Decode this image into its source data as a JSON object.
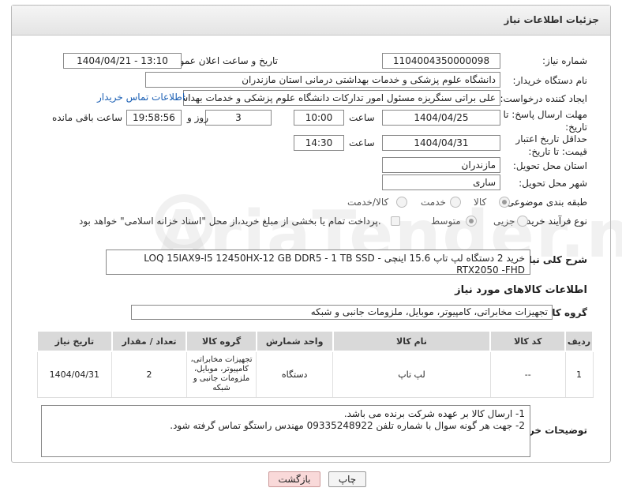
{
  "panel": {
    "title": "جزئیات اطلاعات نیاز"
  },
  "form": {
    "need_number": {
      "label": "شماره نیاز:",
      "value": "1104004350000098"
    },
    "announce": {
      "label": "تاریخ و ساعت اعلان عمومی:",
      "value": "1404/04/21 - 13:10"
    },
    "buyer_org": {
      "label": "نام دستگاه خریدار:",
      "value": "دانشگاه علوم پزشکی و خدمات بهداشتی  درمانی استان مازندران"
    },
    "creator": {
      "label": "ایجاد کننده درخواست:",
      "value": "علی براتی سنگریزه مسئول امور تدارکات دانشگاه علوم پزشکی و خدمات بهداشتی",
      "contact_link": "اطلاعات تماس خریدار"
    },
    "reply_deadline": {
      "label": "مهلت ارسال پاسخ: تا تاریخ:",
      "date": "1404/04/25",
      "time_label": "ساعت",
      "time": "10:00",
      "days": "3",
      "days_label": "روز و",
      "remaining": "19:58:56",
      "remaining_label": "ساعت باقی مانده"
    },
    "price_validity": {
      "label": "حداقل تاریخ اعتبار قیمت: تا تاریخ:",
      "date": "1404/04/31",
      "time_label": "ساعت",
      "time": "14:30"
    },
    "province": {
      "label": "استان محل تحویل:",
      "value": "مازندران"
    },
    "city": {
      "label": "شهر محل تحویل:",
      "value": "ساری"
    },
    "category": {
      "label": "طبقه بندی موضوعی:",
      "options": [
        "کالا",
        "خدمت",
        "کالا/خدمت"
      ],
      "selected": "کالا"
    },
    "process": {
      "label": "نوع فرآیند خرید :",
      "options": [
        "جزیی",
        "متوسط"
      ],
      "selected": "متوسط",
      "note": "پرداخت تمام یا بخشی از مبلغ خرید،از محل \"اسناد خزانه اسلامی\" خواهد بود."
    }
  },
  "description": {
    "label": "شرح کلی نیاز:",
    "value": "خرید 2 دستگاه لپ تاپ  15.6 اینچی LOQ 15IAX9-I5 12450HX-12 GB DDR5 - 1 TB SSD - RTX2050 -FHD"
  },
  "goods": {
    "section_title": "اطلاعات کالاهای مورد نیاز",
    "group_label": "گروه کالا:",
    "group_value": "تجهیزات مخابراتی، کامپیوتر، موبایل، ملزومات جانبی و شبکه",
    "columns": [
      "ردیف",
      "کد کالا",
      "نام کالا",
      "واحد شمارش",
      "گروه کالا",
      "تعداد / مقدار",
      "تاریخ نیاز"
    ],
    "rows": [
      {
        "row": "1",
        "code": "--",
        "name": "لپ تاپ",
        "unit": "دستگاه",
        "group": "تجهیزات مخابراتی، کامپیوتر، موبایل، ملزومات جانبی و شبکه",
        "qty": "2",
        "date": "1404/04/31"
      }
    ]
  },
  "buyer_notes": {
    "label": "توضیحات خریدار:",
    "lines": [
      "1-  ارسال کالا بر عهده شرکت برنده می باشد.",
      "2- جهت هر گونه سوال با شماره تلفن 09335248922 مهندس راستگو تماس گرفته شود."
    ]
  },
  "buttons": {
    "print": "چاپ",
    "back": "بازگشت"
  },
  "watermark": "AriaTender.neT",
  "colors": {
    "link": "#1a5fb4",
    "back_button": "#f9d9d9",
    "header_bg": "#e4e4e4"
  }
}
